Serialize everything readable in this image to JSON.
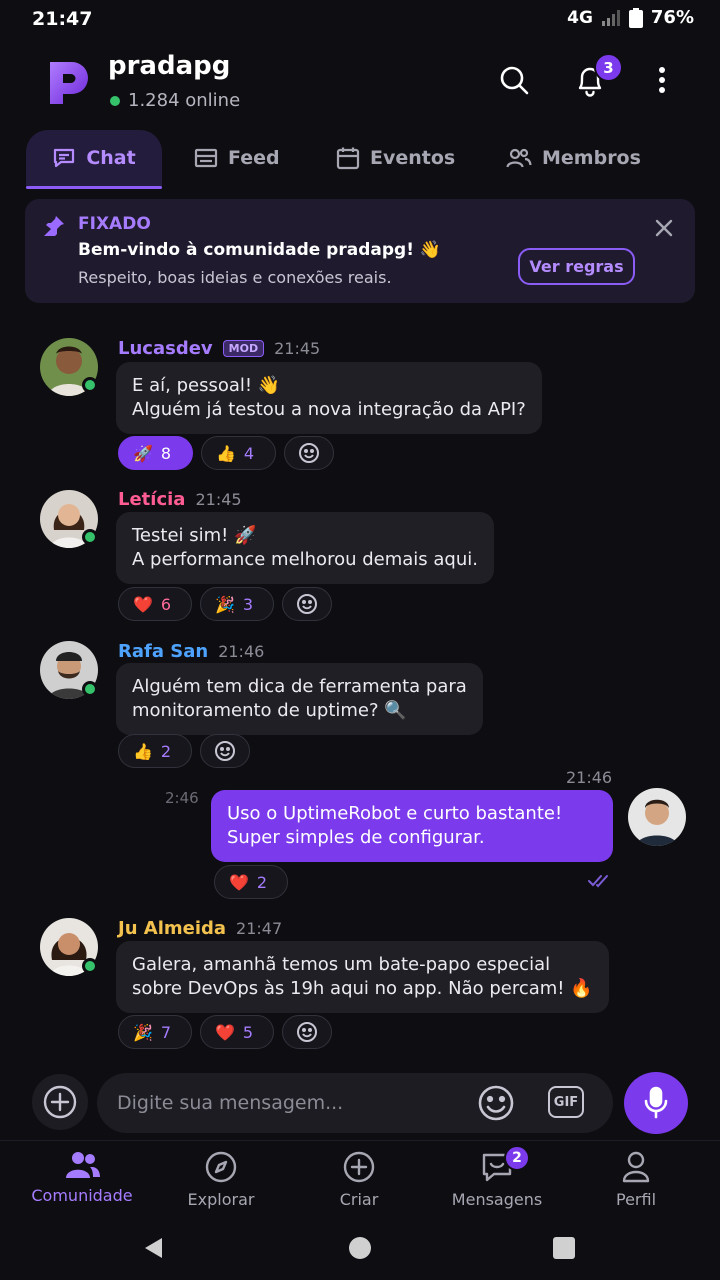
{
  "status_bar": {
    "time": "21:47",
    "network": "4G",
    "battery": "76%"
  },
  "header": {
    "community_name": "pradapg",
    "online_count": "1.284 online",
    "notification_count": "3"
  },
  "tabs": [
    {
      "label": "Chat",
      "icon": "chat-icon",
      "active": true
    },
    {
      "label": "Feed",
      "icon": "feed-icon"
    },
    {
      "label": "Eventos",
      "icon": "calendar-icon"
    },
    {
      "label": "Membros",
      "icon": "members-icon"
    }
  ],
  "pinned": {
    "label": "FIXADO",
    "title": "Bem-vindo à comunidade pradapg! 👋",
    "subtitle": "Respeito, boas ideias e conexões reais.",
    "button": "Ver regras"
  },
  "messages": [
    {
      "author": "Lucasdev",
      "badge": "MOD",
      "time": "21:45",
      "color": "#a67cff",
      "lines": [
        "E aí, pessoal! 👋",
        "Alguém já testou a nova integração da API?"
      ],
      "reactions": [
        {
          "emoji": "🚀",
          "count": "8"
        },
        {
          "emoji": "👍",
          "count": "4"
        }
      ]
    },
    {
      "author": "Letícia",
      "time": "21:45",
      "color": "#ff5c93",
      "lines": [
        "Testei sim! 🚀",
        "A performance melhorou demais aqui."
      ],
      "reactions": [
        {
          "emoji": "❤️",
          "count": "6"
        },
        {
          "emoji": "🎉",
          "count": "3"
        }
      ]
    },
    {
      "author": "Rafa San",
      "time": "21:46",
      "color": "#4ea3ff",
      "lines": [
        "Alguém tem dica de ferramenta para",
        "monitoramento de uptime? 🔍"
      ],
      "reactions": [
        {
          "emoji": "👍",
          "count": "2"
        }
      ]
    },
    {
      "mine": true,
      "time": "21:46",
      "time_left": "2:46",
      "lines": [
        "Uso o UptimeRobot e curto bastante!",
        "Super simples de configurar."
      ],
      "reactions": [
        {
          "emoji": "❤️",
          "count": "2"
        }
      ]
    },
    {
      "author": "Ju Almeida",
      "time": "21:47",
      "color": "#f2c14e",
      "lines": [
        "Galera, amanhã temos um bate-papo especial",
        "sobre DevOps às 19h aqui no app. Não percam! 🔥"
      ],
      "reactions": [
        {
          "emoji": "🎉",
          "count": "7"
        },
        {
          "emoji": "❤️",
          "count": "5"
        }
      ]
    }
  ],
  "composer": {
    "placeholder": "Digite sua mensagem...",
    "gif_label": "GIF"
  },
  "bottom_nav": [
    {
      "label": "Comunidade",
      "icon": "community-icon",
      "active": true
    },
    {
      "label": "Explorar",
      "icon": "compass-icon"
    },
    {
      "label": "Criar",
      "icon": "plus-circle-icon"
    },
    {
      "label": "Mensagens",
      "icon": "messages-icon",
      "badge": "2"
    },
    {
      "label": "Perfil",
      "icon": "profile-icon"
    }
  ],
  "colors": {
    "accent": "#7c3aed",
    "background": "#0e0e12",
    "bubble": "#1f1f25",
    "online": "#35c26b"
  }
}
